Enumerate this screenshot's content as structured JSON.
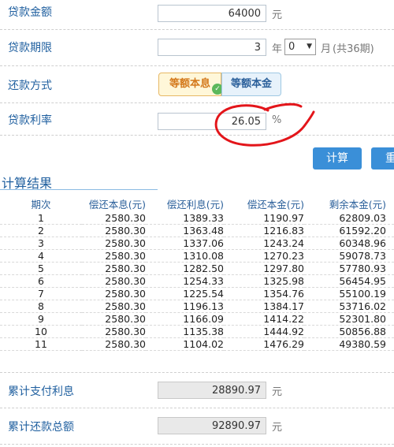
{
  "form": {
    "amount": {
      "label": "贷款金额",
      "value": "64000",
      "unit": "元"
    },
    "term": {
      "label": "贷款期限",
      "years": "3",
      "years_unit": "年",
      "months_select": "0",
      "months_unit": "月",
      "total_note": "(共36期)"
    },
    "method": {
      "label": "还款方式",
      "option_selected": "等额本息",
      "option_other": "等额本金"
    },
    "rate": {
      "label": "贷款利率",
      "value": "26.05",
      "unit": "%"
    }
  },
  "buttons": {
    "calculate": "计算",
    "reset_partial": "重"
  },
  "results": {
    "title": "计算结果",
    "columns": [
      "期次",
      "偿还本息(元)",
      "偿还利息(元)",
      "偿还本金(元)",
      "剩余本金(元)"
    ],
    "rows": [
      [
        "1",
        "2580.30",
        "1389.33",
        "1190.97",
        "62809.03"
      ],
      [
        "2",
        "2580.30",
        "1363.48",
        "1216.83",
        "61592.20"
      ],
      [
        "3",
        "2580.30",
        "1337.06",
        "1243.24",
        "60348.96"
      ],
      [
        "4",
        "2580.30",
        "1310.08",
        "1270.23",
        "59078.73"
      ],
      [
        "5",
        "2580.30",
        "1282.50",
        "1297.80",
        "57780.93"
      ],
      [
        "6",
        "2580.30",
        "1254.33",
        "1325.98",
        "56454.95"
      ],
      [
        "7",
        "2580.30",
        "1225.54",
        "1354.76",
        "55100.19"
      ],
      [
        "8",
        "2580.30",
        "1196.13",
        "1384.17",
        "53716.02"
      ],
      [
        "9",
        "2580.30",
        "1166.09",
        "1414.22",
        "52301.80"
      ],
      [
        "10",
        "2580.30",
        "1135.38",
        "1444.92",
        "50856.88"
      ],
      [
        "11",
        "2580.30",
        "1104.02",
        "1476.29",
        "49380.59"
      ]
    ]
  },
  "summary": {
    "interest": {
      "label": "累计支付利息",
      "value": "28890.97",
      "unit": "元"
    },
    "total": {
      "label": "累计还款总额",
      "value": "92890.97",
      "unit": "元"
    }
  },
  "colors": {
    "accent": "#3a8fd8",
    "label": "#1f5f9f",
    "annotation": "#e3151a"
  }
}
